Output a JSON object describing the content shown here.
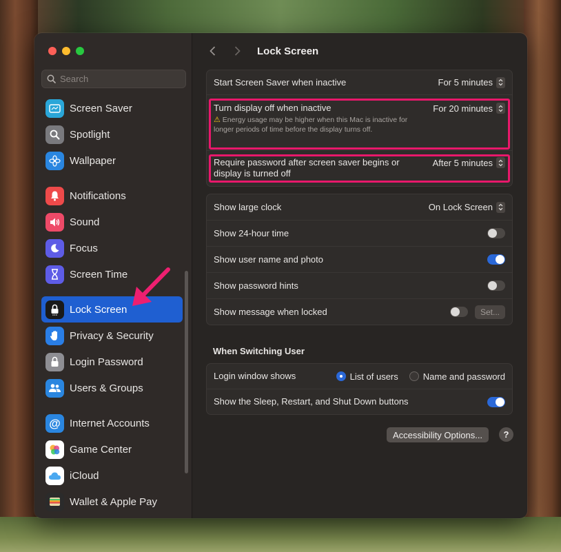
{
  "window": {
    "title": "Lock Screen"
  },
  "search": {
    "placeholder": "Search"
  },
  "sidebar": {
    "groups": [
      [
        {
          "label": "Screen Saver",
          "icon": "screensaver-icon",
          "color": "#2aa6d8"
        },
        {
          "label": "Spotlight",
          "icon": "magnifier-icon",
          "color": "#7a7a7e"
        },
        {
          "label": "Wallpaper",
          "icon": "flower-icon",
          "color": "#2a86e0"
        }
      ],
      [
        {
          "label": "Notifications",
          "icon": "bell-icon",
          "color": "#ee4a4a"
        },
        {
          "label": "Sound",
          "icon": "speaker-icon",
          "color": "#ee4a68"
        },
        {
          "label": "Focus",
          "icon": "moon-icon",
          "color": "#5e5ce6"
        },
        {
          "label": "Screen Time",
          "icon": "hourglass-icon",
          "color": "#5e5ce6"
        }
      ],
      [
        {
          "label": "Lock Screen",
          "icon": "lock-icon",
          "color": "#1a1a1a",
          "active": true
        },
        {
          "label": "Privacy & Security",
          "icon": "hand-icon",
          "color": "#2a7ee6"
        },
        {
          "label": "Login Password",
          "icon": "padlock-icon",
          "color": "#8e8e93"
        },
        {
          "label": "Users & Groups",
          "icon": "users-icon",
          "color": "#2a86e0"
        }
      ],
      [
        {
          "label": "Internet Accounts",
          "icon": "at-icon",
          "color": "#2a86e0"
        },
        {
          "label": "Game Center",
          "icon": "game-center-icon",
          "color": "#ffffff"
        },
        {
          "label": "iCloud",
          "icon": "cloud-icon",
          "color": "#ffffff"
        },
        {
          "label": "Wallet & Apple Pay",
          "icon": "wallet-icon",
          "color": "#2b2b2b"
        }
      ]
    ]
  },
  "screen_saver_group": {
    "start_label": "Start Screen Saver when inactive",
    "start_value": "For 5 minutes",
    "display_off_label": "Turn display off when inactive",
    "display_off_value": "For 20 minutes",
    "display_off_note": "Energy usage may be higher when this Mac is inactive for longer periods of time before the display turns off.",
    "password_label": "Require password after screen saver begins or display is turned off",
    "password_value": "After 5 minutes"
  },
  "clock_group": {
    "large_clock_label": "Show large clock",
    "large_clock_value": "On Lock Screen",
    "hour24_label": "Show 24-hour time",
    "hour24_on": false,
    "user_photo_label": "Show user name and photo",
    "user_photo_on": true,
    "hints_label": "Show password hints",
    "hints_on": false,
    "message_label": "Show message when locked",
    "message_on": false,
    "set_button": "Set..."
  },
  "switching_user": {
    "section_title": "When Switching User",
    "login_window_label": "Login window shows",
    "option_list": "List of users",
    "option_name": "Name and password",
    "selected": "List of users",
    "sleep_buttons_label": "Show the Sleep, Restart, and Shut Down buttons",
    "sleep_buttons_on": true
  },
  "footer": {
    "accessibility_button": "Accessibility Options...",
    "help_button": "?"
  },
  "colors": {
    "accent": "#1f5fd1",
    "highlight": "#e8186b"
  }
}
